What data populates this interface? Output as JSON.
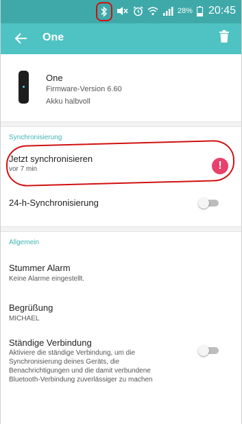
{
  "status_bar": {
    "battery_percent": "28%",
    "time": "20:45",
    "icons": [
      "bluetooth-icon",
      "mute-icon",
      "alarm-icon",
      "wifi-icon",
      "signal-icon",
      "battery-icon"
    ]
  },
  "app_bar": {
    "title": "One"
  },
  "device": {
    "name": "One",
    "firmware": "Firmware-Version 6.60",
    "battery": "Akku halbvoll"
  },
  "sync_section": {
    "header": "Synchronisierung",
    "sync_now": {
      "title": "Jetzt synchronisieren",
      "subtitle": "vor 7 min",
      "alert": "!"
    },
    "all_day_sync": {
      "title": "24-h-Synchronisierung",
      "enabled": false
    }
  },
  "general_section": {
    "header": "Allgemein",
    "silent_alarm": {
      "title": "Stummer Alarm",
      "subtitle": "Keine Alarme eingestellt."
    },
    "greeting": {
      "title": "Begrüßung",
      "subtitle": "MICHAEL"
    },
    "always_connected": {
      "title": "Ständige Verbindung",
      "description_lines": [
        "Aktiviere die ständige Verbindung, um die",
        "Synchronisierung deines Geräts, die",
        "Benachrichtigungen und die damit verbundene",
        "Bluetooth-Verbindung zuverlässiger zu machen"
      ],
      "enabled": false
    }
  },
  "colors": {
    "status_bar": "#3fa9a9",
    "app_bar": "#4fc3c3",
    "accent": "#3fb3b3",
    "alert": "#e8416b",
    "annotation": "#d01010"
  }
}
